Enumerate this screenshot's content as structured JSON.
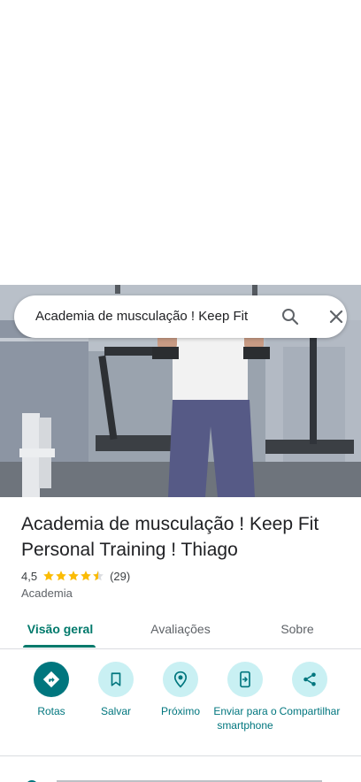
{
  "search": {
    "query": "Academia de musculação ! Keep Fit"
  },
  "place": {
    "title": "Academia de musculação ! Keep Fit Personal Training ! Thiago",
    "rating": "4,5",
    "rating_stars": 4.5,
    "review_count": "(29)",
    "category": "Academia"
  },
  "tabs": [
    {
      "label": "Visão geral",
      "active": true
    },
    {
      "label": "Avaliações",
      "active": false
    },
    {
      "label": "Sobre",
      "active": false
    }
  ],
  "actions": [
    {
      "label": "Rotas",
      "icon": "directions-icon"
    },
    {
      "label": "Salvar",
      "icon": "bookmark-icon"
    },
    {
      "label": "Próximo",
      "icon": "nearby-icon"
    },
    {
      "label": "Enviar para o smartphone",
      "icon": "send-to-phone-icon"
    },
    {
      "label": "Compartilhar",
      "icon": "share-icon"
    }
  ],
  "colors": {
    "accent": "#00767e",
    "tab_active": "#00796b",
    "star": "#fbbc04",
    "chip_bg": "#c9f0f3"
  }
}
